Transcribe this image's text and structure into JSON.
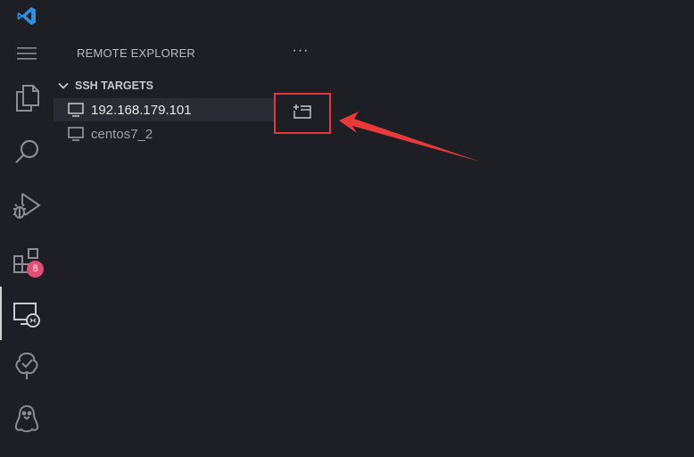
{
  "activity_bar": {
    "items": [
      {
        "name": "vscode-logo-icon"
      },
      {
        "name": "menu-icon"
      },
      {
        "name": "explorer-icon"
      },
      {
        "name": "search-icon"
      },
      {
        "name": "run-debug-icon"
      },
      {
        "name": "extensions-icon",
        "badge": "8"
      },
      {
        "name": "remote-explorer-icon",
        "active": true
      },
      {
        "name": "tree-check-icon"
      },
      {
        "name": "penguin-icon"
      }
    ],
    "badge_color": "#e04f77"
  },
  "sidebar": {
    "title": "REMOTE EXPLORER",
    "more_label": "···",
    "section": {
      "label": "SSH TARGETS",
      "items": [
        {
          "label": "192.168.179.101",
          "selected": true
        },
        {
          "label": "centos7_2",
          "selected": false
        }
      ]
    }
  },
  "annotation": {
    "highlight_color": "#e0383e",
    "target": "connect-in-new-window-button"
  }
}
